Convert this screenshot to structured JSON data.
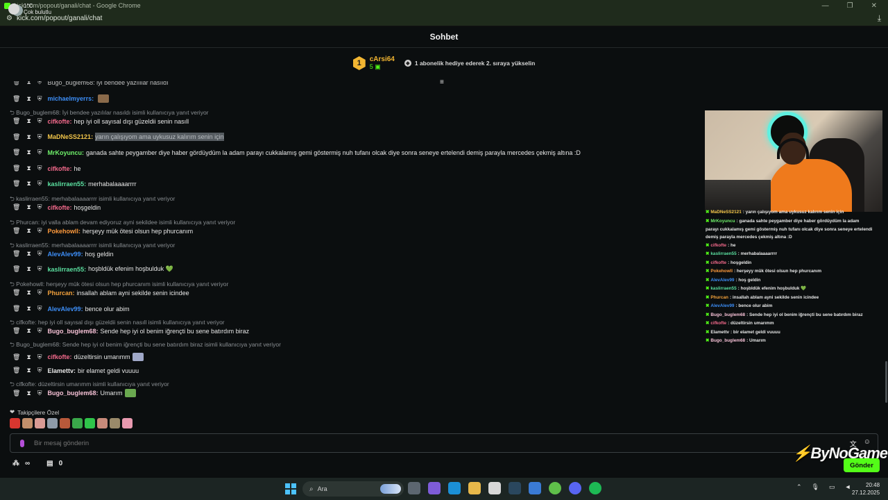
{
  "browser": {
    "title": "kick.com/popout/ganali/chat - Google Chrome",
    "url": "kick.com/popout/ganali/chat"
  },
  "chat": {
    "header": "Sohbet",
    "leaderboard": {
      "rank": "1",
      "name": "cArsi64",
      "count": "5",
      "gift_text": "1 abonelik hediye ederek 2. sıraya yükselin"
    },
    "top_partial": "Bugo_buglem68: iyi bendee yazılılar nasıldı",
    "messages": [
      {
        "type": "msg",
        "user": "michaelmyerrs",
        "color": "#3d8ef7",
        "text": "",
        "emote": "#8a6a4a"
      },
      {
        "type": "reply",
        "text": "Bugo_buglem68: İyi bendee yazılılar nasıldı isimli kullanıcıya yanıt veriyor"
      },
      {
        "type": "msg",
        "user": "cifkofte",
        "color": "#f46a8c",
        "text": "hep iyi oll sayısal dışı güzeldii senin nasıll"
      },
      {
        "type": "msg",
        "user": "MaDNeSS2121",
        "color": "#f3c64a",
        "text": "yarın çalışıyom ama uykusuz kalırım senin için",
        "highlight": true
      },
      {
        "type": "msg",
        "user": "MrKoyuncu",
        "color": "#6ff06a",
        "text": "ganada sahte peygamber diye haber gördüydüm la adam parayı cukkalamış gemi göstermiş nuh tufanı olcak diye sonra seneye ertelendi demiş parayla mercedes çekmiş altına :D"
      },
      {
        "type": "msg",
        "user": "cifkofte",
        "color": "#f46a8c",
        "text": "he"
      },
      {
        "type": "msg",
        "user": "kaslirraen55",
        "color": "#5be0a0",
        "text": "merhabalaaaarrrr"
      },
      {
        "type": "reply",
        "text": "kaslirraen55: merhabalaaaarrrr isimli kullanıcıya yanıt veriyor"
      },
      {
        "type": "msg",
        "user": "cifkofte",
        "color": "#f46a8c",
        "text": "hoşgeldin"
      },
      {
        "type": "reply",
        "text": "Phurcan: iyi valla ablam devam ediyoruz ayni sekildee isimli kullanıcıya yanıt veriyor"
      },
      {
        "type": "msg",
        "user": "Pokehowll",
        "color": "#ff9a3c",
        "text": "herşeyy mük ötesi olsun hep phurcanım"
      },
      {
        "type": "reply",
        "text": "kaslirraen55: merhabalaaaarrrr isimli kullanıcıya yanıt veriyor"
      },
      {
        "type": "msg",
        "user": "AlevAlev99",
        "color": "#3d8ef7",
        "text": "hoş geldin"
      },
      {
        "type": "msg",
        "user": "kaslirraen55",
        "color": "#5be0a0",
        "text": "hoşbldük efenim hoşbulduk 💚"
      },
      {
        "type": "reply",
        "text": "Pokehowll: herşeyy mük ötesi olsun hep phurcanım isimli kullanıcıya yanıt veriyor"
      },
      {
        "type": "msg",
        "user": "Phurcan",
        "color": "#f3a23c",
        "text": "insallah ablam ayni sekilde senin icindee"
      },
      {
        "type": "msg",
        "user": "AlevAlev99",
        "color": "#3d8ef7",
        "text": "bence olur abim"
      },
      {
        "type": "reply",
        "text": "cifkofte: hep iyi oll sayısal dışı güzeldii senin nasıll isimli kullanıcıya yanıt veriyor"
      },
      {
        "type": "msg",
        "user": "Bugo_buglem68",
        "color": "#f6c1d6",
        "text": "Sende hep iyi ol benim iğrençti bu sene batırdım biraz"
      },
      {
        "type": "reply",
        "text": "Bugo_buglem68: Sende hep iyi ol benim iğrençti bu sene batırdım biraz isimli kullanıcıya yanıt veriyor"
      },
      {
        "type": "msg",
        "user": "cifkofte",
        "color": "#f46a8c",
        "text": "düzeltirsin umarımm",
        "emote": "#a0a8c8"
      },
      {
        "type": "msg",
        "user": "Elamettv",
        "color": "#e8e8e8",
        "text": "bir elamet geldi vuuuu"
      },
      {
        "type": "reply",
        "text": "cifkofte: düzeltirsin umarımm     isimli kullanıcıya yanıt veriyor"
      },
      {
        "type": "msg",
        "user": "Bugo_buglem68",
        "color": "#f6c1d6",
        "text": "Umarım",
        "emote": "#6aa84f"
      }
    ],
    "followers_label": "Takipçilere Özel",
    "emote_colors": [
      "#d8362f",
      "#c28f6b",
      "#d99a94",
      "#8e9aa8",
      "#b8593a",
      "#3aa84a",
      "#2fc44a",
      "#c88a7a",
      "#9a8a6a",
      "#e89ab0"
    ],
    "input_placeholder": "Bir mesaj gönderin",
    "bottom": {
      "infinity": "∞",
      "count": "0"
    },
    "send_label": "Gönder",
    "watermark": "ByNoGame"
  },
  "overlay": {
    "lines": [
      {
        "user": "MaDNeSS2121",
        "color": "#f3c64a",
        "text": ": yarın çalışıyom ama uykusuz kalırım senin için"
      },
      {
        "user": "MrKoyuncu",
        "color": "#6ff06a",
        "text": ": ganada sahte peygamber diye haber gördüydüm la adam"
      },
      {
        "user": "",
        "color": "#e8e8e8",
        "text": "parayı cukkalamış gemi göstermiş nuh tufanı olcak diye sonra seneye ertelendi"
      },
      {
        "user": "",
        "color": "#e8e8e8",
        "text": "demiş parayla mercedes çekmiş altına :D"
      },
      {
        "user": "cifkofte",
        "color": "#f46a8c",
        "text": ": he"
      },
      {
        "user": "kaslirraen55",
        "color": "#5be0a0",
        "text": ": merhabalaaaarrrr"
      },
      {
        "user": "cifkofte",
        "color": "#f46a8c",
        "text": ": hoşgeldin"
      },
      {
        "user": "Pokehowll",
        "color": "#ff9a3c",
        "text": ": herşeyy mük ötesi olsun hep phurcanım"
      },
      {
        "user": "AlevAlev99",
        "color": "#3d8ef7",
        "text": ": hoş geldin"
      },
      {
        "user": "kaslirraen55",
        "color": "#5be0a0",
        "text": ": hoşbldük efenim hoşbulduk 💚"
      },
      {
        "user": "Phurcan",
        "color": "#f3a23c",
        "text": ": insallah ablam ayni sekilde senin icindee"
      },
      {
        "user": "AlevAlev99",
        "color": "#3d8ef7",
        "text": ": bence olur abim"
      },
      {
        "user": "Bugo_buglem68",
        "color": "#f6c1d6",
        "text": ": Sende hep iyi ol benim iğrençti bu sene batırdım biraz"
      },
      {
        "user": "cifkofte",
        "color": "#f46a8c",
        "text": ": düzeltirsin umarımm"
      },
      {
        "user": "Elamettv",
        "color": "#e8e8e8",
        "text": ": bir elamet geldi vuuuu"
      },
      {
        "user": "Bugo_buglem68",
        "color": "#f6c1d6",
        "text": ": Umarım"
      }
    ]
  },
  "taskbar": {
    "temp": "1°C",
    "weather": "Çok bulutlu",
    "search_label": "Ara",
    "time": "20:48",
    "date": "27.12.2025",
    "app_colors": [
      "#5c6670",
      "#7e5cd8",
      "#1b8fd6",
      "#e8b84a",
      "#d8d8d8",
      "#2a475e",
      "#3a7bd5",
      "#5fbf4a",
      "#5865f2",
      "#1db954"
    ]
  }
}
